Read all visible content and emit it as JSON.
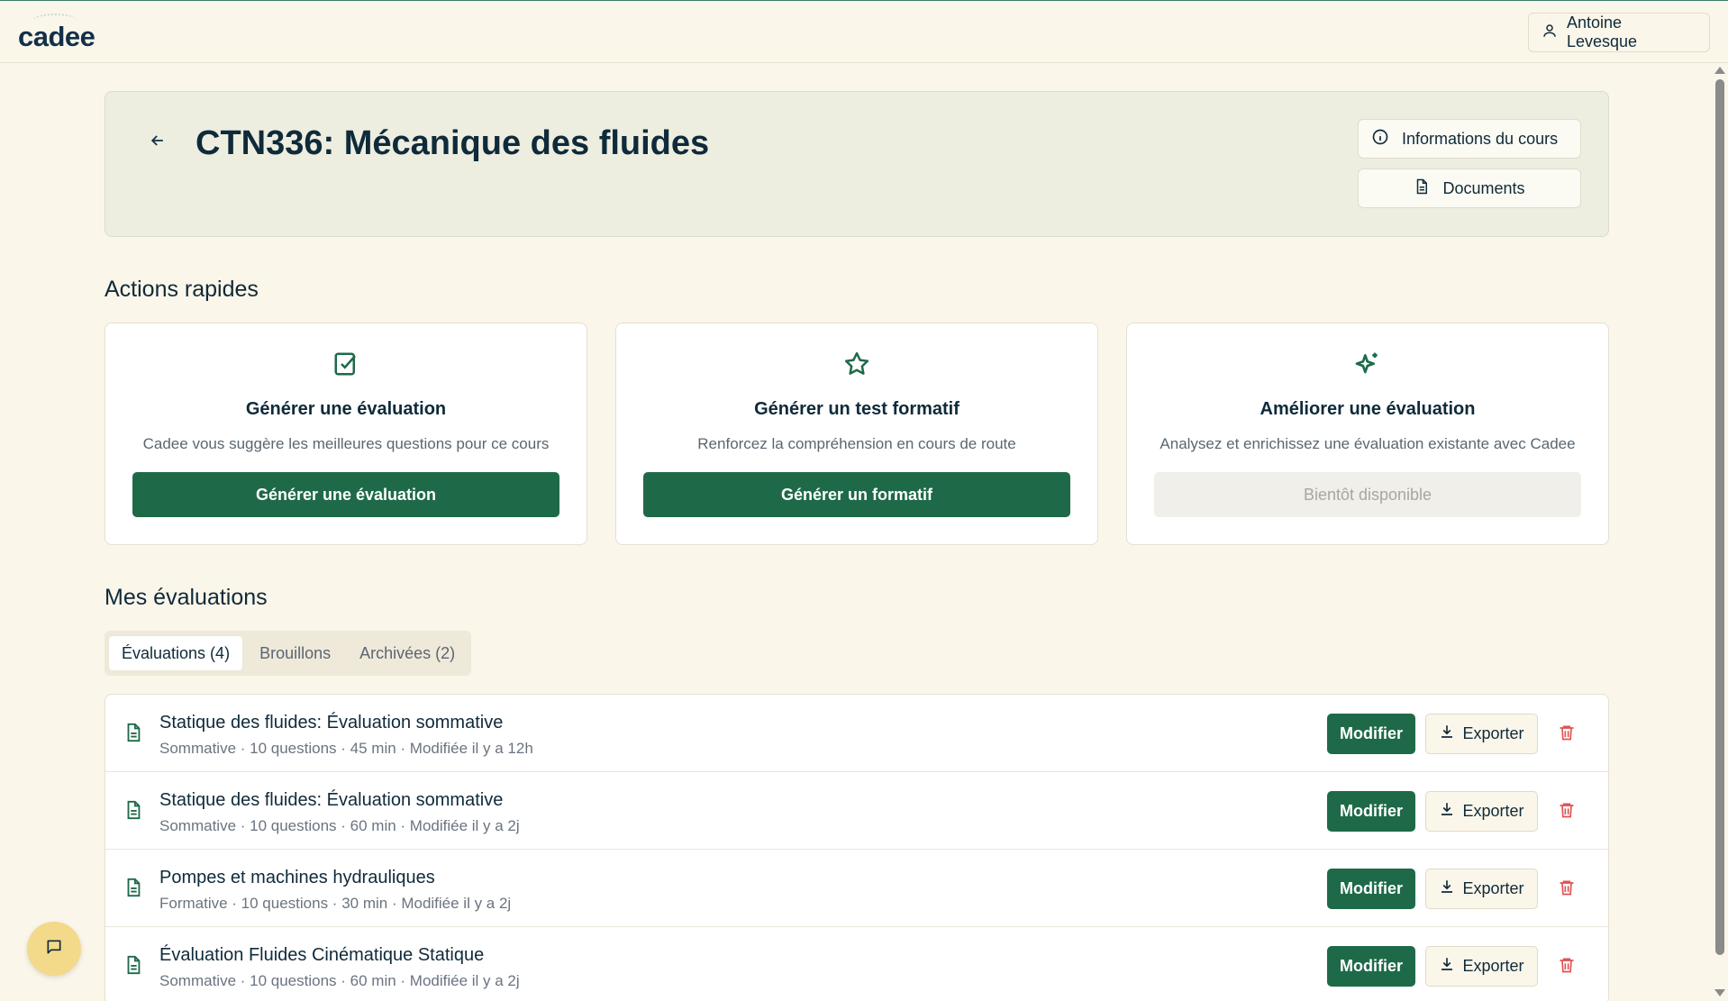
{
  "app": {
    "logo": "cadee",
    "user_name": "Antoine Levesque"
  },
  "hero": {
    "title": "CTN336: Mécanique des fluides",
    "info_button": "Informations du cours",
    "documents_button": "Documents"
  },
  "quick_actions": {
    "heading": "Actions rapides",
    "cards": [
      {
        "icon": "check-square-icon",
        "title": "Générer une évaluation",
        "desc": "Cadee vous suggère les meilleures questions pour ce cours",
        "button": "Générer une évaluation",
        "disabled": false
      },
      {
        "icon": "star-icon",
        "title": "Générer un test formatif",
        "desc": "Renforcez la compréhension en cours de route",
        "button": "Générer un formatif",
        "disabled": false
      },
      {
        "icon": "sparkles-icon",
        "title": "Améliorer une évaluation",
        "desc": "Analysez et enrichissez une évaluation existante avec Cadee",
        "button": "Bientôt disponible",
        "disabled": true
      }
    ]
  },
  "evaluations": {
    "heading": "Mes évaluations",
    "tabs": [
      {
        "label": "Évaluations (4)",
        "active": true
      },
      {
        "label": "Brouillons",
        "active": false
      },
      {
        "label": "Archivées (2)",
        "active": false
      }
    ],
    "modify_label": "Modifier",
    "export_label": "Exporter",
    "items": [
      {
        "title": "Statique des fluides: Évaluation sommative",
        "meta": "Sommative · 10 questions · 45 min · Modifiée il y a 12h"
      },
      {
        "title": "Statique des fluides: Évaluation sommative",
        "meta": "Sommative · 10 questions · 60 min · Modifiée il y a 2j"
      },
      {
        "title": "Pompes et machines hydrauliques",
        "meta": "Formative · 10 questions · 30 min · Modifiée il y a 2j"
      },
      {
        "title": "Évaluation Fluides Cinématique Statique",
        "meta": "Sommative · 10 questions · 60 min · Modifiée il y a 2j"
      }
    ]
  },
  "colors": {
    "primary": "#1e6a48",
    "background": "#fbf6ea",
    "danger": "#e05252",
    "chat_fab": "#f3d98a"
  }
}
